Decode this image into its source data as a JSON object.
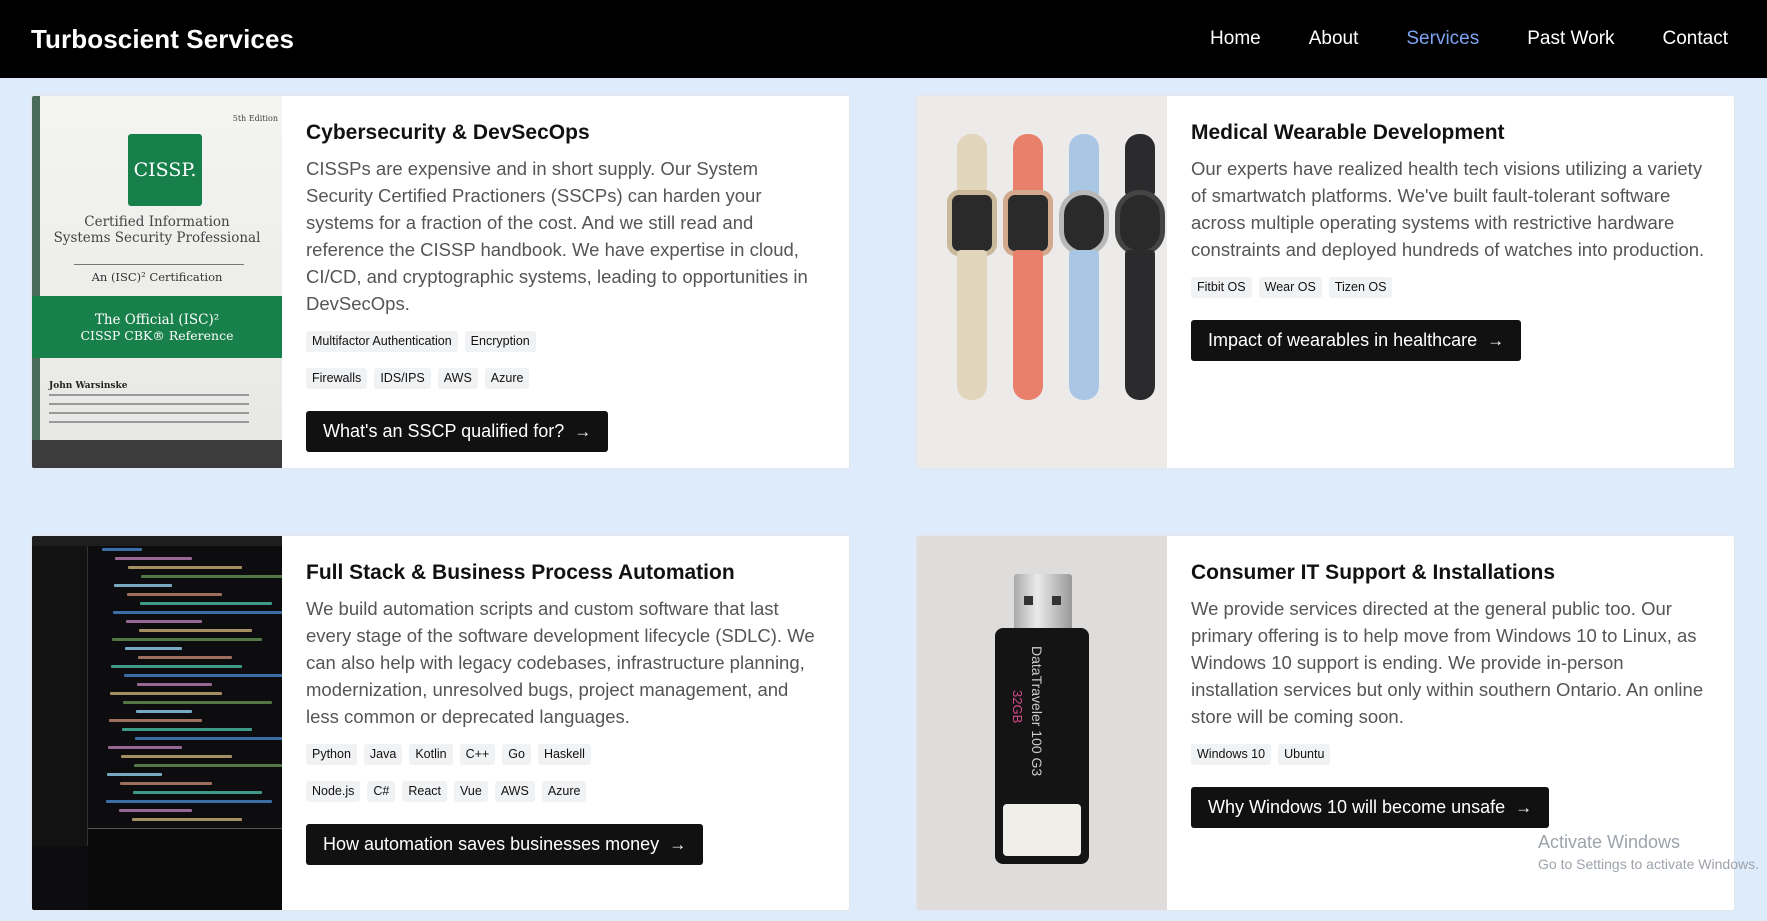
{
  "nav": {
    "brand": "Turboscient Services",
    "links": [
      {
        "label": "Home",
        "active": false
      },
      {
        "label": "About",
        "active": false
      },
      {
        "label": "Services",
        "active": true
      },
      {
        "label": "Past Work",
        "active": false
      },
      {
        "label": "Contact",
        "active": false
      }
    ],
    "active_color": "#7ea3f0"
  },
  "cards": [
    {
      "title": "Cybersecurity & DevSecOps",
      "description": "CISSPs are expensive and in short supply. Our System Security Certified Practioners (SSCPs) can harden your systems for a fraction of the cost. And we still read and reference the CISSP handbook. We have expertise in cloud, CI/CD, and cryptographic systems, leading to opportunities in DevSecOps.",
      "badges": [
        "Multifactor Authentication",
        "Encryption",
        "Firewalls",
        "IDS/IPS",
        "AWS",
        "Azure"
      ],
      "cta": "What's an SSCP qualified for?",
      "image": {
        "edition": "5th Edition",
        "logo": "CISSP.",
        "line1": "Certified Information",
        "line2": "Systems Security Professional",
        "line3": "An (ISC)² Certification",
        "ref1": "The Official (ISC)²",
        "ref2": "CISSP CBK® Reference",
        "author": "John Warsinske"
      }
    },
    {
      "title": "Medical Wearable Development",
      "description": "Our experts have realized health tech visions utilizing a variety of smartwatch platforms. We've built fault-tolerant software across multiple operating systems with restrictive hardware constraints and deployed hundreds of watches into production.",
      "badges": [
        "Fitbit OS",
        "Wear OS",
        "Tizen OS"
      ],
      "cta": "Impact of wearables in healthcare"
    },
    {
      "title": "Full Stack & Business Process Automation",
      "description": "We build automation scripts and custom software that last every stage of the software development lifecycle (SDLC). We can also help with legacy codebases, infrastructure planning, modernization, unresolved bugs, project management, and less common or deprecated languages.",
      "badges": [
        "Python",
        "Java",
        "Kotlin",
        "C++",
        "Go",
        "Haskell",
        "Node.js",
        "C#",
        "React",
        "Vue",
        "AWS",
        "Azure"
      ],
      "cta": "How automation saves businesses money"
    },
    {
      "title": "Consumer IT Support & Installations",
      "description": "We provide services directed at the general public too. Our primary offering is to help move from Windows 10 to Linux, as Windows 10 support is ending. We provide in-person installation services but only within southern Ontario. An online store will be coming soon.",
      "badges": [
        "Windows 10",
        "Ubuntu"
      ],
      "cta": "Why Windows 10 will become unsafe",
      "image": {
        "brand": "DataTraveler 100 G3",
        "capacity": "32GB"
      }
    }
  ],
  "watermark": {
    "title": "Activate Windows",
    "subtitle": "Go to Settings to activate Windows."
  }
}
